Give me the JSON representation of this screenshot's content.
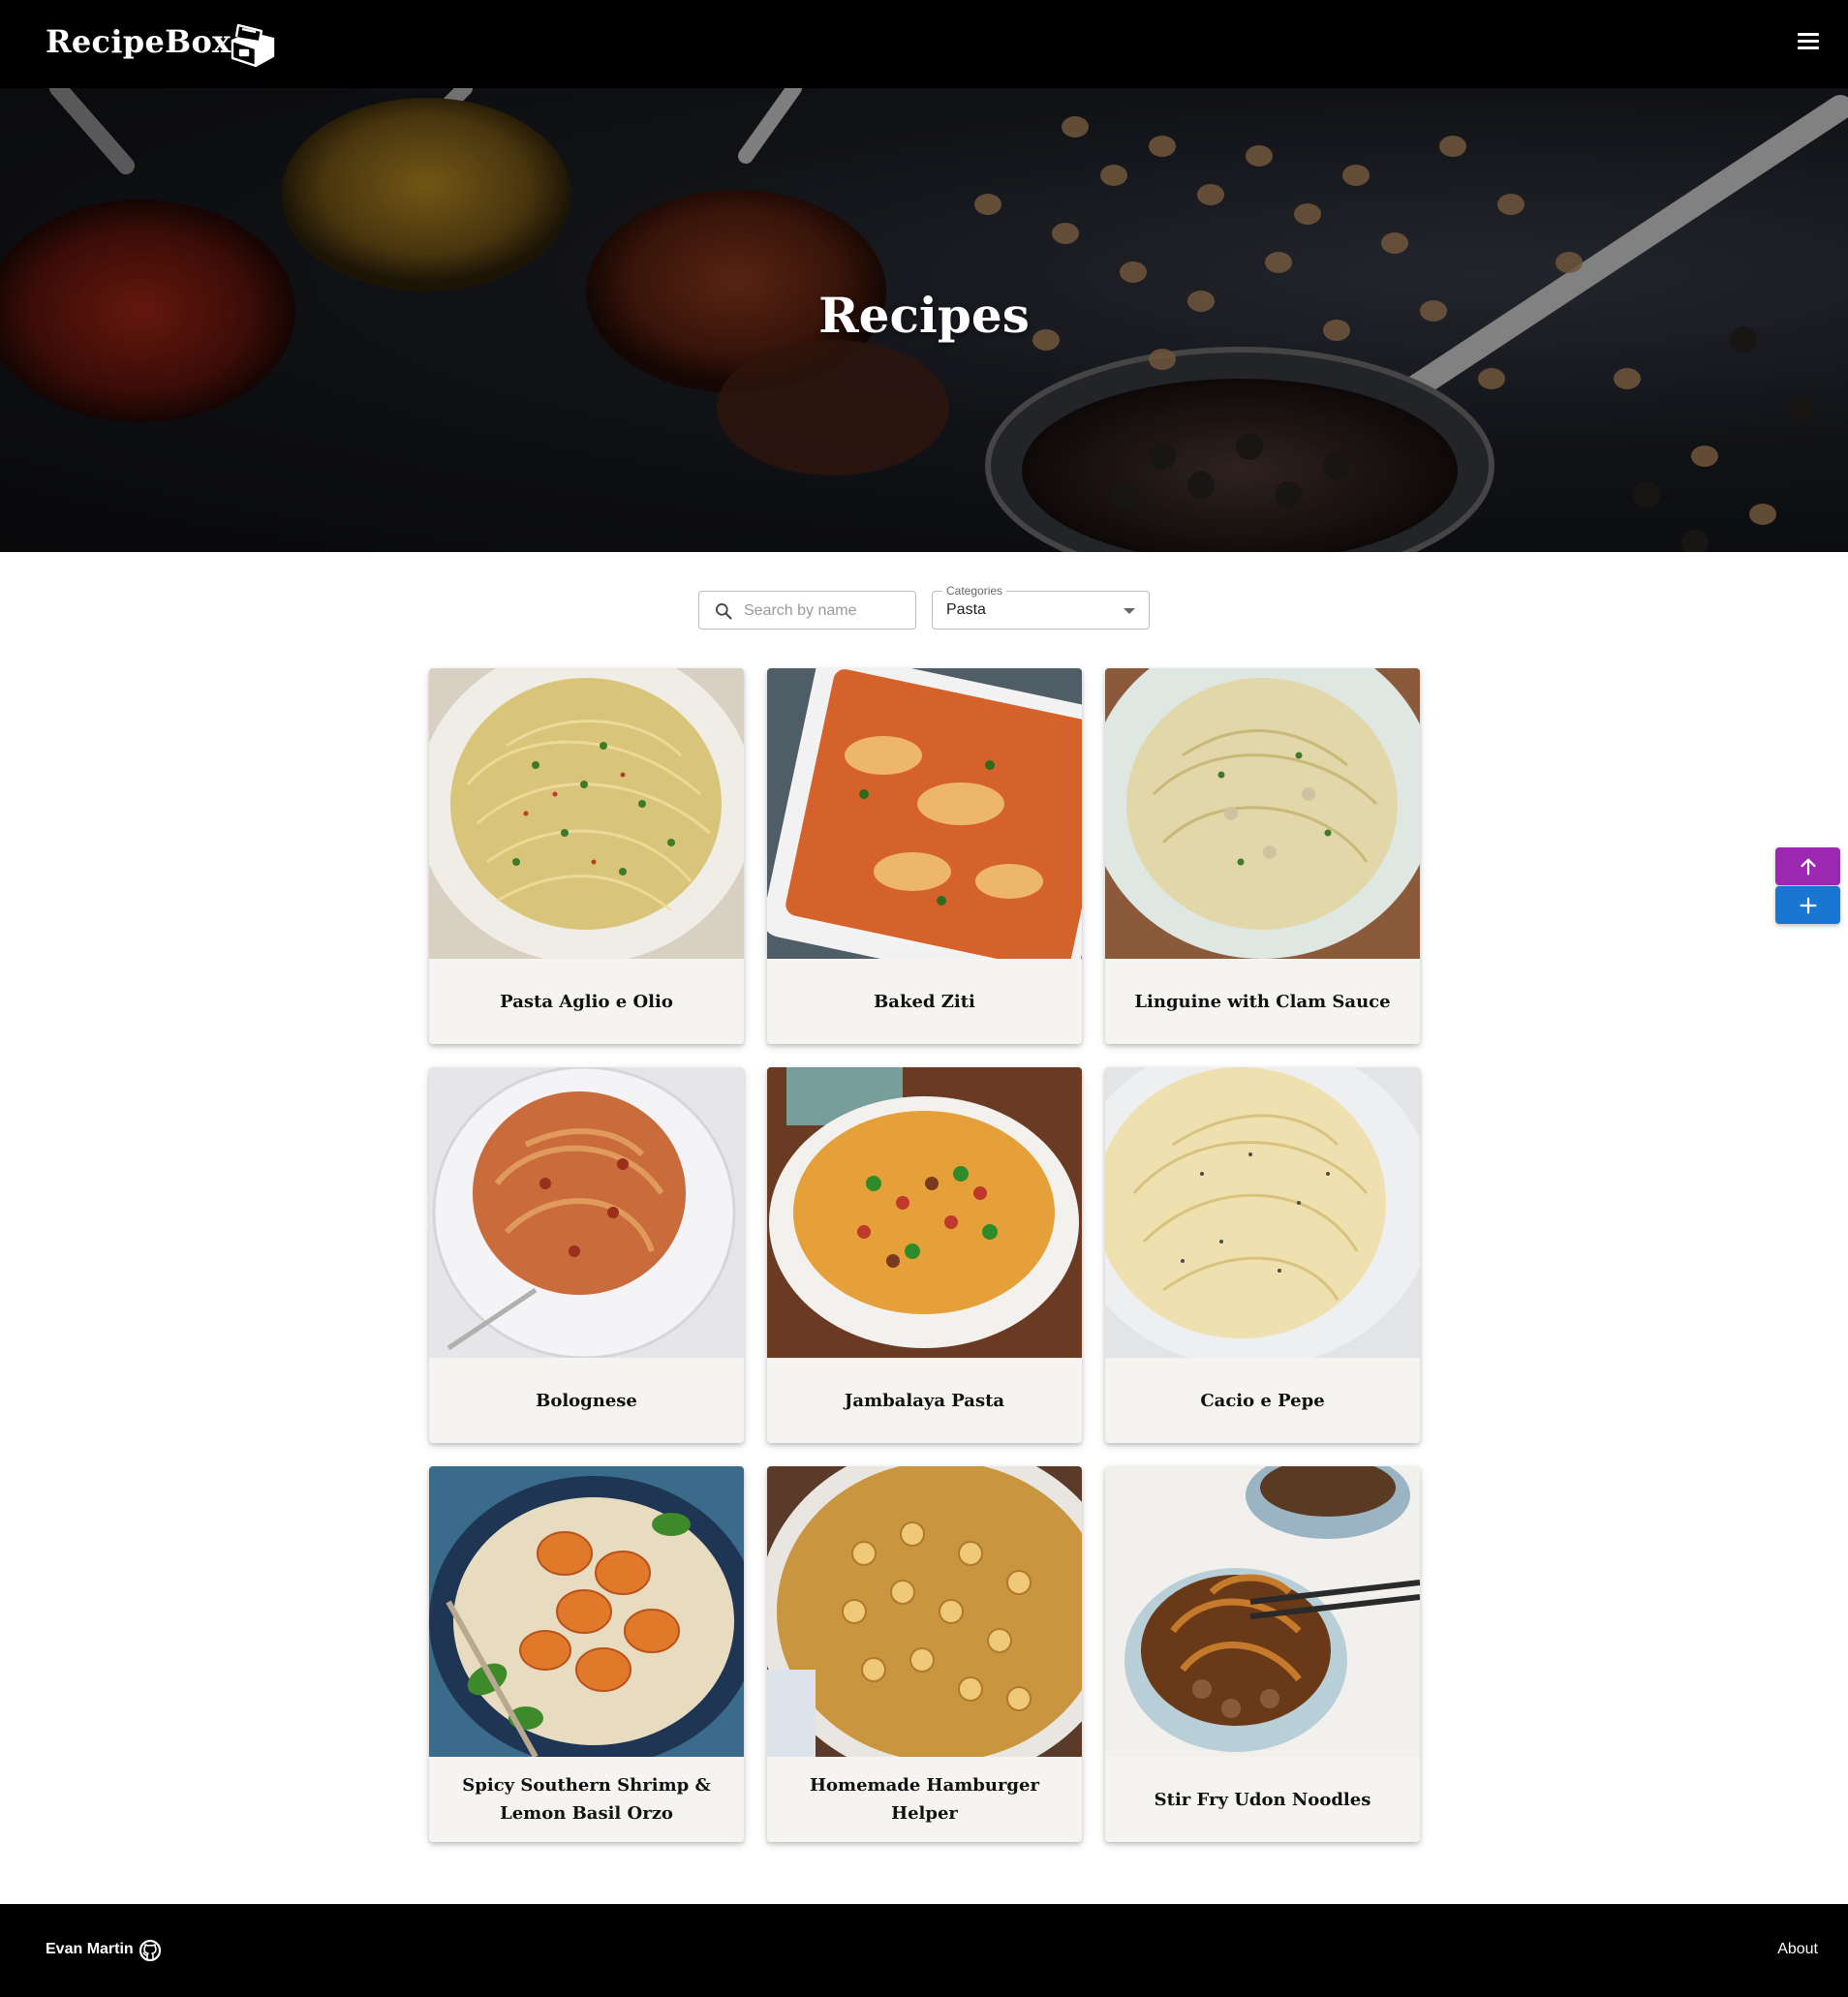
{
  "header": {
    "brand": "RecipeBox",
    "logo_icon": "recipe-box-icon",
    "menu_icon": "menu-icon"
  },
  "hero": {
    "title": "Recipes"
  },
  "filters": {
    "search_placeholder": "Search by name",
    "search_value": "",
    "categories_label": "Categories",
    "categories_value": "Pasta"
  },
  "recipes": [
    {
      "title": "Pasta Aglio e Olio"
    },
    {
      "title": "Baked Ziti"
    },
    {
      "title": "Linguine with Clam Sauce"
    },
    {
      "title": "Bolognese"
    },
    {
      "title": "Jambalaya Pasta"
    },
    {
      "title": "Cacio e Pepe"
    },
    {
      "title": "Spicy Southern Shrimp & Lemon Basil Orzo"
    },
    {
      "title": "Homemade Hamburger Helper"
    },
    {
      "title": "Stir Fry Udon Noodles"
    }
  ],
  "fab": {
    "up_icon": "arrow-up-icon",
    "add_icon": "plus-icon",
    "up_color": "#9c27b0",
    "add_color": "#1976d2"
  },
  "footer": {
    "author": "Evan Martin",
    "github_icon": "github-icon",
    "about": "About"
  }
}
